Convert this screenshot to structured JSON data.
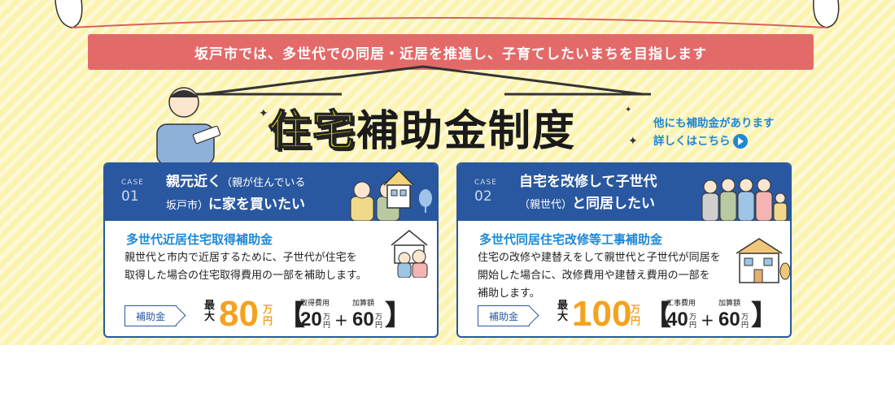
{
  "banner": {
    "text": "坂戸市では、多世代での同居・近居を推進し、子育てしたいまちを目指します"
  },
  "title": {
    "highlight": "住宅",
    "main": "補助金制度"
  },
  "other_link": {
    "line1": "他にも補助金があります",
    "line2": "詳しくはこちら"
  },
  "colors": {
    "accent_blue": "#2a58a0",
    "link_blue": "#1e88d6",
    "ribbon_red": "#e46a6a",
    "amount_orange": "#f4a21f",
    "title_yellow": "#f5e313",
    "bg_yellow": "#fbf3b0"
  },
  "cases": [
    {
      "label": "CASE",
      "number": "01",
      "heading_line1_main": "親元近く",
      "heading_line1_small": "（親が住んでいる",
      "heading_line2_small": "坂戸市）",
      "heading_line2_main": "に家を買いたい",
      "subsidy_name": "多世代近居住宅取得補助金",
      "description_line1": "親世代と市内で近居するために、子世代が住宅を",
      "description_line2": "取得した場合の住宅取得費用の一部を補助します。",
      "badge": "補助金",
      "max_label": "最大",
      "amount": "80",
      "unit": "万円",
      "breakdown": [
        {
          "label": "取得費用",
          "value": "20",
          "unit": "万円"
        },
        {
          "label": "加算額",
          "value": "60",
          "unit": "万円"
        }
      ],
      "plus": "+"
    },
    {
      "label": "CASE",
      "number": "02",
      "heading_line1_main": "自宅を改修して子世代",
      "heading_line2_small": "（親世代）",
      "heading_line2_main": "と同居したい",
      "subsidy_name": "多世代同居住宅改修等工事補助金",
      "description_line1": "住宅の改修や建替えをして親世代と子世代が同居を",
      "description_line2": "開始した場合に、改修費用や建替え費用の一部を",
      "description_line3": "補助します。",
      "badge": "補助金",
      "max_label": "最大",
      "amount": "100",
      "unit": "万円",
      "breakdown": [
        {
          "label": "工事費用",
          "value": "40",
          "unit": "万円"
        },
        {
          "label": "加算額",
          "value": "60",
          "unit": "万円"
        }
      ],
      "plus": "+"
    }
  ],
  "icons": [
    "sparkle-icon",
    "play-icon",
    "house-icon",
    "tree-icon",
    "family-icon",
    "worker-illustration"
  ]
}
